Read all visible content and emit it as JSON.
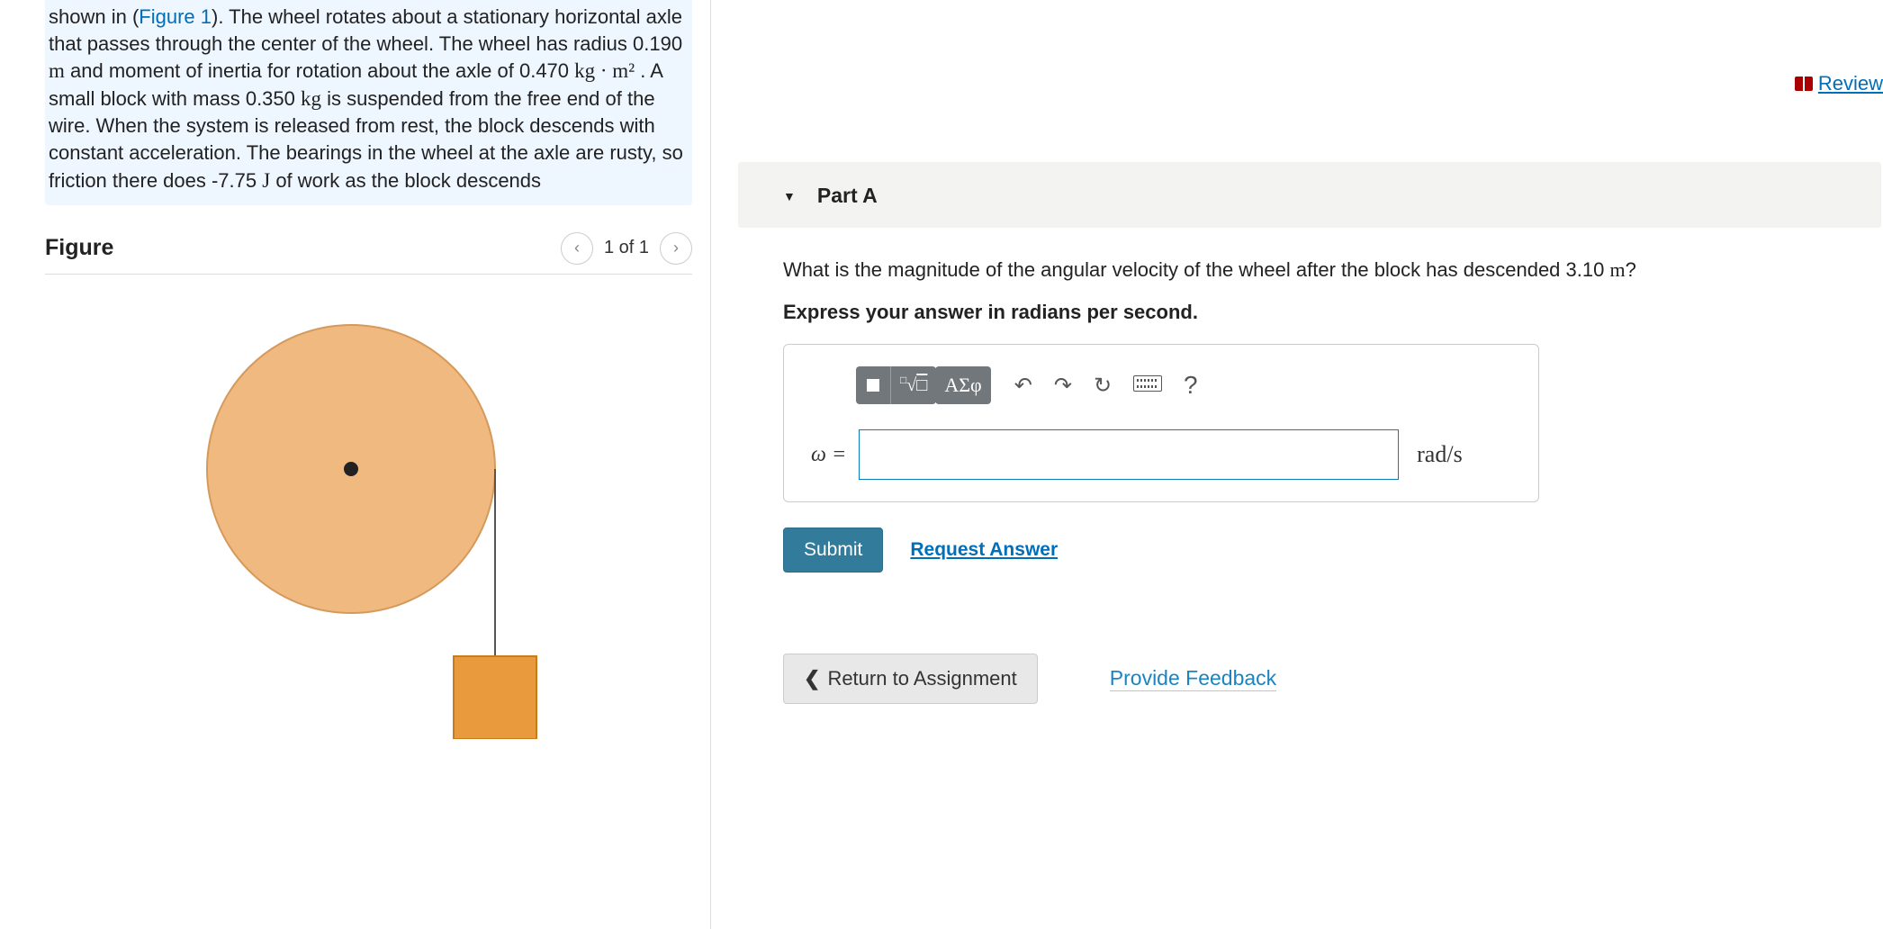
{
  "problem": {
    "intro_html": "shown in (<a href=\"#\" class=\"fig-link\">Figure 1</a>). The wheel rotates about a stationary horizontal axle that passes through the center of the wheel. The wheel has radius 0.190 <span class=\"unit\">m</span> and moment of inertia for rotation about the axle of 0.470 <span class=\"unit\">kg · m²</span> . A small block with mass 0.350 <span class=\"unit\">kg</span> is suspended from the free end of the wire. When the system is released from rest, the block descends with constant acceleration. The bearings in the wheel at the axle are rusty, so friction there does -7.75 <span class=\"unit\">J</span> of work as the block descends"
  },
  "figure": {
    "heading": "Figure",
    "counter": "1 of 1"
  },
  "review": {
    "label": "Review"
  },
  "part": {
    "title": "Part A",
    "question_html": "What is the magnitude of the angular velocity of the wheel after the block has descended 3.10 <span class=\"unit\" style=\"font-family:'Times New Roman',serif;\">m</span>?",
    "instruction": "Express your answer in radians per second.",
    "answer": {
      "variable_html": "ω =",
      "value": "",
      "unit_html": "rad/s",
      "placeholder": ""
    },
    "toolbar": {
      "templates": "▭√▭",
      "greek": "ΑΣφ"
    },
    "submit_label": "Submit",
    "request_label": "Request Answer"
  },
  "bottom": {
    "return_label": "Return to Assignment",
    "feedback_label": "Provide Feedback"
  }
}
